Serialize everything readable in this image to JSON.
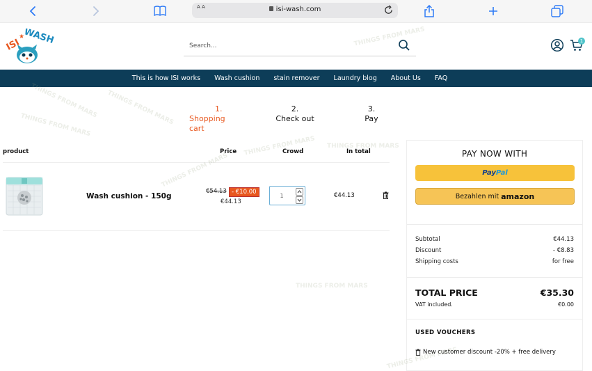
{
  "browser": {
    "reader_label": "A A",
    "url": "isi-wash.com",
    "icons": [
      "back-icon",
      "forward-icon",
      "bookmarks-icon",
      "lock-icon",
      "reload-icon",
      "share-icon",
      "new-tab-icon",
      "tabs-icon"
    ]
  },
  "header": {
    "logo_text": "ISI WASH",
    "search_placeholder": "Search...",
    "cart_count": "1"
  },
  "nav": {
    "items": [
      "This is how ISI works",
      "Wash cushion",
      "stain remover",
      "Laundry blog",
      "About Us",
      "FAQ"
    ]
  },
  "steps": [
    {
      "number": "1.",
      "label": "Shopping cart",
      "active": true
    },
    {
      "number": "2.",
      "label": "Check out",
      "active": false
    },
    {
      "number": "3.",
      "label": "Pay",
      "active": false
    }
  ],
  "cart": {
    "columns": {
      "product": "product",
      "price": "Price",
      "crowd": "Crowd",
      "total": "In total"
    },
    "items": [
      {
        "name": "Wash cushion - 150g",
        "old_price": "€54.13",
        "discount": "- €10.00",
        "price": "€44.13",
        "quantity": "1",
        "total": "€44.13"
      }
    ]
  },
  "summary": {
    "heading": "PAY NOW WITH",
    "paypal": {
      "pay": "Pay",
      "pal": "Pal"
    },
    "amazon": {
      "label": "Bezahlen mit",
      "brand": "amazon"
    },
    "subtotal_label": "Subtotal",
    "subtotal": "€44.13",
    "discount_label": "Discount",
    "discount": "- €8.83",
    "shipping_label": "Shipping costs",
    "shipping": "for free",
    "total_label": "TOTAL PRICE",
    "total": "€35.30",
    "vat_label": "VAT included.",
    "vat": "€0.00",
    "vouchers_heading": "USED VOUCHERS",
    "voucher": "New customer discount -20% + free delivery"
  },
  "watermark": "THINGS FROM MARS",
  "colors": {
    "nav_bg": "#0d3d58",
    "accent": "#e8571e",
    "paypal": "#f7c23a",
    "amazon": "#f6c456",
    "badge": "#4fc3c9"
  }
}
